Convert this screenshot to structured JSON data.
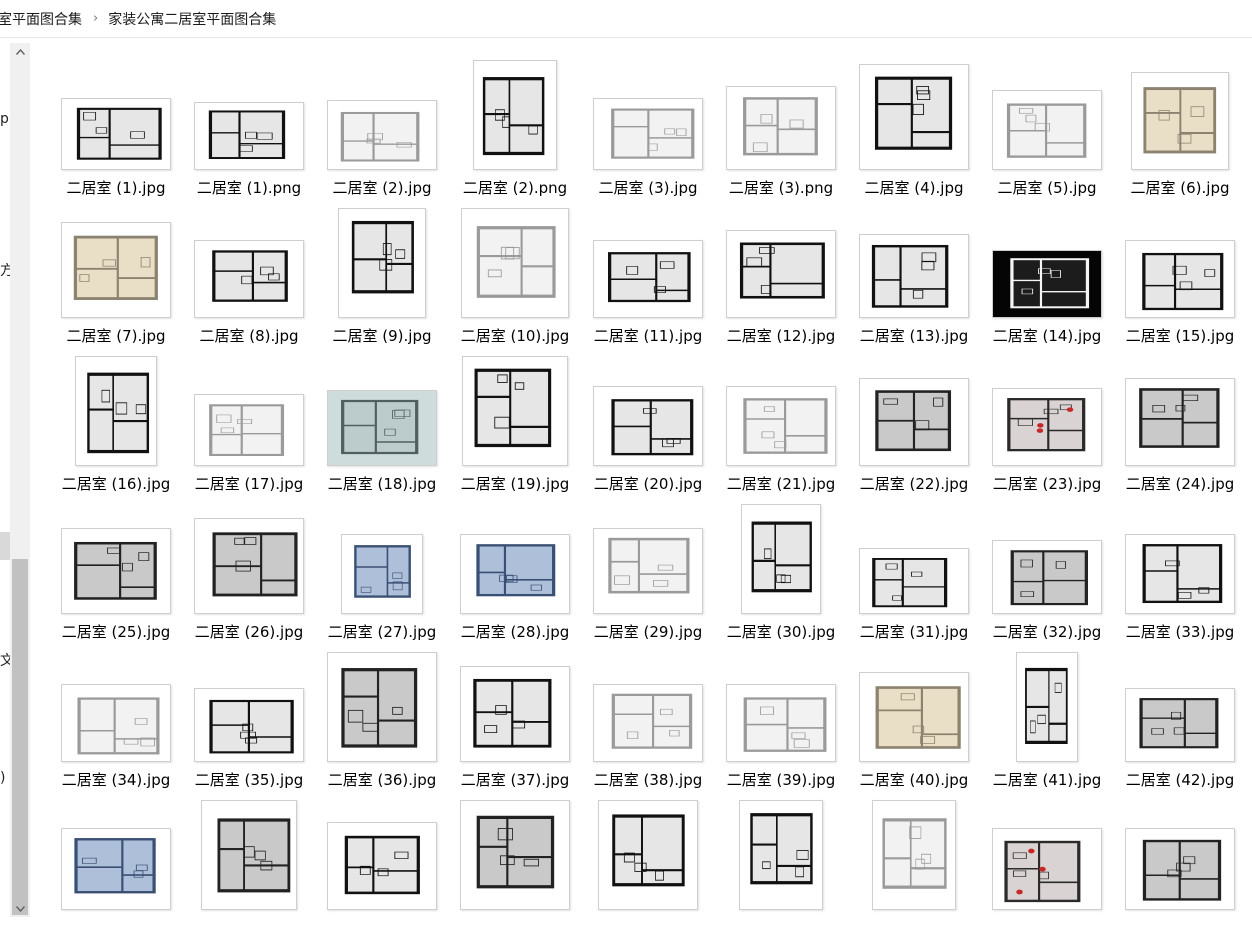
{
  "breadcrumb": {
    "items": [
      "室平面图合集",
      "家装公寓二居室平面图合集"
    ],
    "separator": "›"
  },
  "nav_fragments": [
    "p",
    "方",
    "文",
    ")"
  ],
  "scrollbar": {
    "up_glyph": "▲",
    "down_glyph": "▼"
  },
  "files": [
    {
      "name": "二居室 (1).jpg",
      "style": "plan"
    },
    {
      "name": "二居室 (1).png",
      "style": "plan"
    },
    {
      "name": "二居室 (2).jpg",
      "style": "light"
    },
    {
      "name": "二居室 (2).png",
      "style": "plan"
    },
    {
      "name": "二居室 (3).jpg",
      "style": "light"
    },
    {
      "name": "二居室 (3).png",
      "style": "light"
    },
    {
      "name": "二居室 (4).jpg",
      "style": "plan"
    },
    {
      "name": "二居室 (5).jpg",
      "style": "light"
    },
    {
      "name": "二居室 (6).jpg",
      "style": "beige"
    },
    {
      "name": "二居室 (7).jpg",
      "style": "beige"
    },
    {
      "name": "二居室 (8).jpg",
      "style": "plan"
    },
    {
      "name": "二居室 (9).jpg",
      "style": "plan"
    },
    {
      "name": "二居室 (10).jpg",
      "style": "light"
    },
    {
      "name": "二居室 (11).jpg",
      "style": "plan"
    },
    {
      "name": "二居室 (12).jpg",
      "style": "plan"
    },
    {
      "name": "二居室 (13).jpg",
      "style": "plan"
    },
    {
      "name": "二居室 (14).jpg",
      "style": "dark"
    },
    {
      "name": "二居室 (15).jpg",
      "style": "plan"
    },
    {
      "name": "二居室 (16).jpg",
      "style": "plan"
    },
    {
      "name": "二居室 (17).jpg",
      "style": "light"
    },
    {
      "name": "二居室 (18).jpg",
      "style": "teal"
    },
    {
      "name": "二居室 (19).jpg",
      "style": "plan"
    },
    {
      "name": "二居室 (20).jpg",
      "style": "plan"
    },
    {
      "name": "二居室 (21).jpg",
      "style": "light"
    },
    {
      "name": "二居室 (22).jpg",
      "style": "grey"
    },
    {
      "name": "二居室 (23).jpg",
      "style": "red"
    },
    {
      "name": "二居室 (24).jpg",
      "style": "grey"
    },
    {
      "name": "二居室 (25).jpg",
      "style": "grey"
    },
    {
      "name": "二居室 (26).jpg",
      "style": "grey"
    },
    {
      "name": "二居室 (27).jpg",
      "style": "blue"
    },
    {
      "name": "二居室 (28).jpg",
      "style": "blue"
    },
    {
      "name": "二居室 (29).jpg",
      "style": "light"
    },
    {
      "name": "二居室 (30).jpg",
      "style": "plan"
    },
    {
      "name": "二居室 (31).jpg",
      "style": "plan"
    },
    {
      "name": "二居室 (32).jpg",
      "style": "grey"
    },
    {
      "name": "二居室 (33).jpg",
      "style": "plan"
    },
    {
      "name": "二居室 (34).jpg",
      "style": "light"
    },
    {
      "name": "二居室 (35).jpg",
      "style": "plan"
    },
    {
      "name": "二居室 (36).jpg",
      "style": "grey"
    },
    {
      "name": "二居室 (37).jpg",
      "style": "plan"
    },
    {
      "name": "二居室 (38).jpg",
      "style": "light"
    },
    {
      "name": "二居室 (39).jpg",
      "style": "light"
    },
    {
      "name": "二居室 (40).jpg",
      "style": "beige"
    },
    {
      "name": "二居室 (41).jpg",
      "style": "plan"
    },
    {
      "name": "二居室 (42).jpg",
      "style": "grey"
    },
    {
      "name": "",
      "style": "blue"
    },
    {
      "name": "",
      "style": "grey"
    },
    {
      "name": "",
      "style": "plan"
    },
    {
      "name": "",
      "style": "grey"
    },
    {
      "name": "",
      "style": "plan"
    },
    {
      "name": "",
      "style": "plan"
    },
    {
      "name": "",
      "style": "light"
    },
    {
      "name": "",
      "style": "red"
    },
    {
      "name": "",
      "style": "grey"
    }
  ],
  "palette": {
    "plan": {
      "bg": "#ffffff",
      "fill": "#e6e6e6",
      "wall": "#111111"
    },
    "light": {
      "bg": "#ffffff",
      "fill": "#f2f2f2",
      "wall": "#9a9a9a"
    },
    "beige": {
      "bg": "#ffffff",
      "fill": "#e9dfc6",
      "wall": "#8c8270"
    },
    "dark": {
      "bg": "#050505",
      "fill": "#1c1c1c",
      "wall": "#f5f5f5"
    },
    "teal": {
      "bg": "#cfdcdc",
      "fill": "#bccbcb",
      "wall": "#506060"
    },
    "grey": {
      "bg": "#ffffff",
      "fill": "#c9c9c9",
      "wall": "#222222"
    },
    "blue": {
      "bg": "#ffffff",
      "fill": "#aebfd9",
      "wall": "#3a4f74"
    },
    "red": {
      "bg": "#ffffff",
      "fill": "#d9d3d3",
      "wall": "#2a2a2a",
      "accent": "#c62828"
    }
  }
}
